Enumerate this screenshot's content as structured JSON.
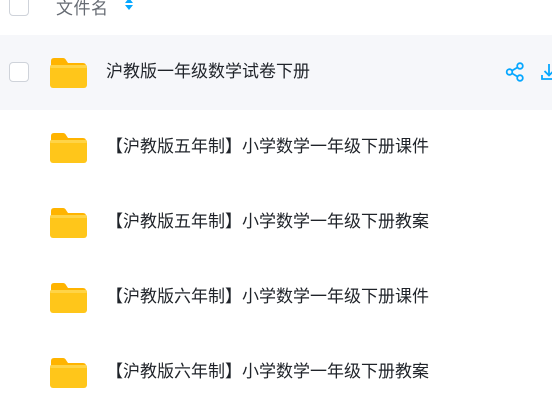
{
  "header": {
    "column_name": "文件名"
  },
  "files": [
    {
      "name": "沪教版一年级数学试卷下册",
      "type": "folder",
      "hovered": true
    },
    {
      "name": "【沪教版五年制】小学数学一年级下册课件",
      "type": "folder",
      "hovered": false
    },
    {
      "name": "【沪教版五年制】小学数学一年级下册教案",
      "type": "folder",
      "hovered": false
    },
    {
      "name": "【沪教版六年制】小学数学一年级下册课件",
      "type": "folder",
      "hovered": false
    },
    {
      "name": "【沪教版六年制】小学数学一年级下册教案",
      "type": "folder",
      "hovered": false
    }
  ],
  "icons": {
    "folder": "folder-icon",
    "share": "share-icon",
    "download": "download-icon",
    "sort": "sort-icon"
  },
  "colors": {
    "accent": "#06a7ff",
    "folder_body": "#ffc61a",
    "folder_tab": "#ffb400",
    "hover_row": "#f6f7fa"
  }
}
